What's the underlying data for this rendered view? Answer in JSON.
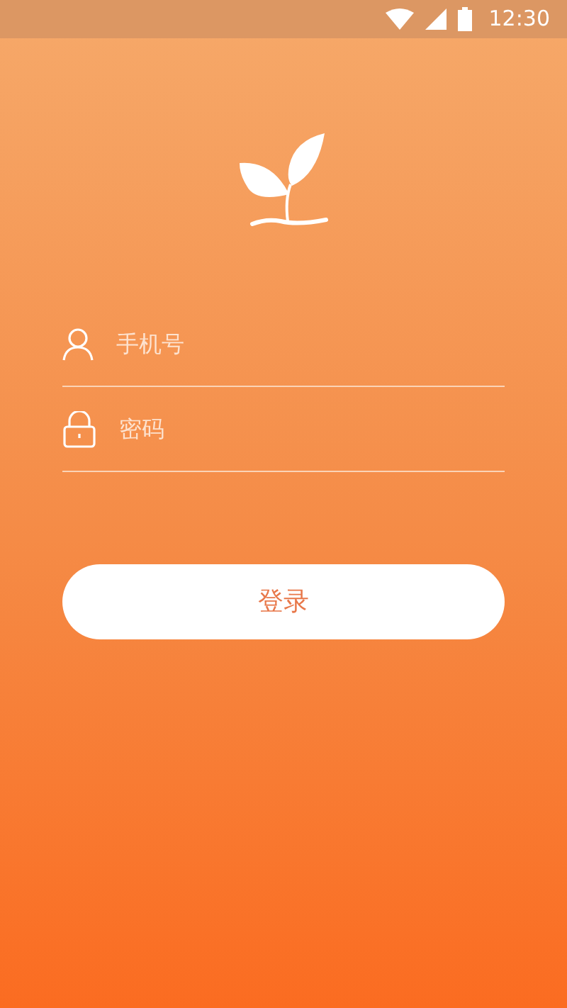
{
  "status_bar": {
    "time": "12:30"
  },
  "form": {
    "fields": [
      {
        "kind": "phone",
        "placeholder": "手机号"
      },
      {
        "kind": "password",
        "placeholder": "密码"
      }
    ],
    "submit": "登录"
  }
}
